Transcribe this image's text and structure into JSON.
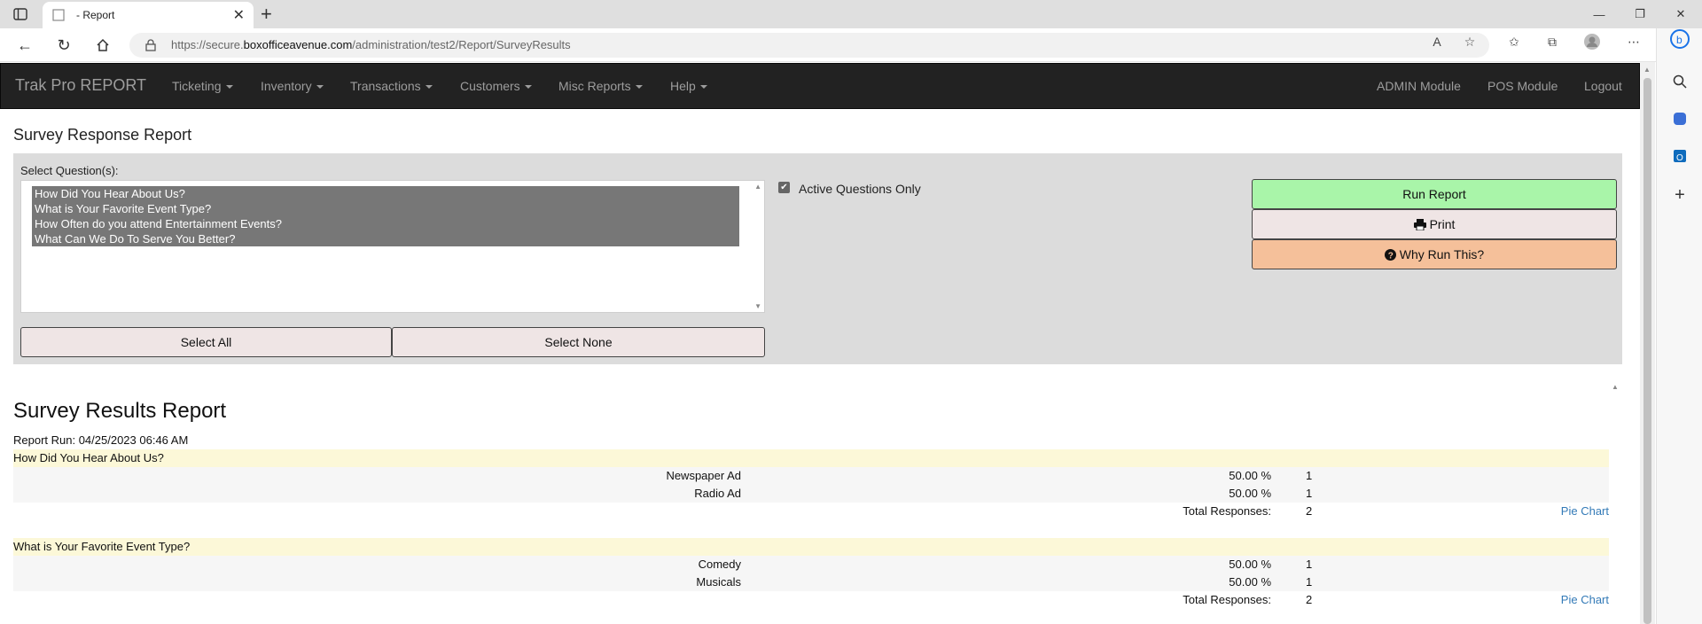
{
  "browser": {
    "tab_title": "- Report",
    "url_prefix": "https://secure.",
    "url_domain": "boxofficeavenue.com",
    "url_path": "/administration/test2/Report/SurveyResults"
  },
  "nav": {
    "brand": "Trak Pro REPORT",
    "menus": [
      "Ticketing",
      "Inventory",
      "Transactions",
      "Customers",
      "Misc Reports",
      "Help"
    ],
    "right": [
      "ADMIN Module",
      "POS Module",
      "Logout"
    ]
  },
  "page_title": "Survey Response Report",
  "filter": {
    "select_label": "Select Question(s):",
    "questions": [
      "How Did You Hear About Us?",
      "What is Your Favorite Event Type?",
      "How Often do you attend Entertainment Events?",
      "What Can We Do To Serve You Better?"
    ],
    "select_all": "Select All",
    "select_none": "Select None",
    "active_only_label": "Active Questions Only",
    "run_report": "Run Report",
    "print": "Print",
    "why": "Why Run This?"
  },
  "results": {
    "title": "Survey Results Report",
    "report_run": "Report Run: 04/25/2023 06:46 AM",
    "total_label": "Total Responses:",
    "pie_link": "Pie Chart",
    "sections": [
      {
        "question": "How Did You Hear About Us?",
        "answers": [
          {
            "answer": "Newspaper Ad",
            "pct": "50.00 %",
            "count": "1"
          },
          {
            "answer": "Radio Ad",
            "pct": "50.00 %",
            "count": "1"
          }
        ],
        "total": "2"
      },
      {
        "question": "What is Your Favorite Event Type?",
        "answers": [
          {
            "answer": "Comedy",
            "pct": "50.00 %",
            "count": "1"
          },
          {
            "answer": "Musicals",
            "pct": "50.00 %",
            "count": "1"
          }
        ],
        "total": "2"
      }
    ]
  }
}
